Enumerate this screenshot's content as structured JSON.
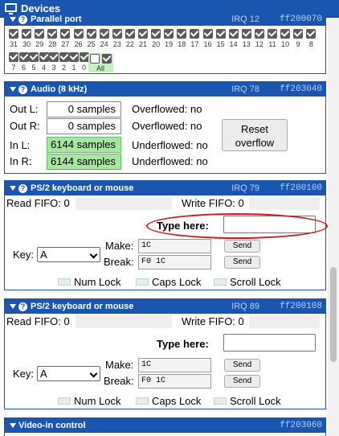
{
  "window": {
    "title": "Devices"
  },
  "parallel": {
    "title": "Parallel port",
    "irq": "IRQ 12",
    "addr": "ff200070",
    "bits_row1": [
      "31",
      "30",
      "29",
      "28",
      "27",
      "26",
      "25",
      "24",
      "23",
      "22",
      "21",
      "20",
      "19",
      "18",
      "17",
      "16",
      "15",
      "14",
      "13",
      "12",
      "11",
      "10",
      "9",
      "8"
    ],
    "bits_row2": [
      "7",
      "6",
      "5",
      "4",
      "3",
      "2",
      "1",
      "0"
    ],
    "all_label": "All"
  },
  "audio": {
    "title": "Audio (8 kHz)",
    "irq": "IRQ 78",
    "addr": "ff203040",
    "out_l_label": "Out L:",
    "out_r_label": "Out R:",
    "in_l_label": "In L:",
    "in_r_label": "In R:",
    "out_l_value": "0 samples",
    "out_r_value": "0 samples",
    "in_l_value": "6144 samples",
    "in_r_value": "6144 samples",
    "overflow_l": "Overflowed: no",
    "overflow_r": "Overflowed: no",
    "underflow_l": "Underflowed: no",
    "underflow_r": "Underflowed: no",
    "reset_label_1": "Reset",
    "reset_label_2": "overflow"
  },
  "ps2_1": {
    "title": "PS/2 keyboard or mouse",
    "irq": "IRQ 79",
    "addr": "ff200100",
    "read_fifo": "Read FIFO: 0",
    "write_fifo": "Write FIFO: 0",
    "type_here": "Type here:",
    "key_label": "Key:",
    "key_value": "A",
    "make_label": "Make:",
    "break_label": "Break:",
    "make_value": "1C",
    "break_value": "F0 1C",
    "send_label": "Send",
    "num_lock": "Num Lock",
    "caps_lock": "Caps Lock",
    "scroll_lock": "Scroll Lock",
    "highlight_color": "#d11a1a"
  },
  "ps2_2": {
    "title": "PS/2 keyboard or mouse",
    "irq": "IRQ 89",
    "addr": "ff200108",
    "read_fifo": "Read FIFO: 0",
    "write_fifo": "Write FIFO: 0",
    "type_here": "Type here:",
    "key_label": "Key:",
    "key_value": "A",
    "make_label": "Make:",
    "break_label": "Break:",
    "make_value": "1C",
    "break_value": "F0 1C",
    "send_label": "Send",
    "num_lock": "Num Lock",
    "caps_lock": "Caps Lock",
    "scroll_lock": "Scroll Lock"
  },
  "video": {
    "title": "Video-in control",
    "addr": "ff203060"
  },
  "colors": {
    "accent": "#1a56b0",
    "checkbox": "#5b5b5b",
    "green_field": "#a6e6a1"
  }
}
